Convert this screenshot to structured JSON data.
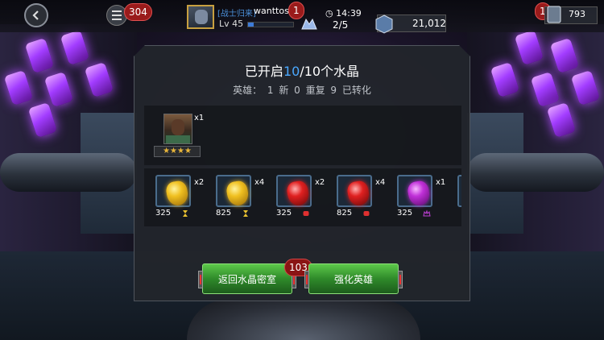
{
  "topbar": {
    "menu_badge": "304",
    "alliance_tag": "[战士归来]",
    "player_name": "wanttose",
    "level": "Lv 45",
    "xp_progress": 0.12,
    "profile_badge": "1",
    "timer": "14:39",
    "energy": "2/5",
    "gold": "21,012",
    "unit_badge": "1",
    "units": "793"
  },
  "dialog": {
    "title_prefix": "已开启",
    "title_count": "10",
    "title_suffix": "/10个水晶",
    "subtitle": "英雄： 1 新 0 重复 9 已转化",
    "hero": {
      "multiplier": "x1",
      "stars": "★★★★"
    },
    "crystals": [
      {
        "color": "gold",
        "multiplier": "x2",
        "value": "325",
        "type_icon": "hourglass-icon"
      },
      {
        "color": "gold",
        "multiplier": "x4",
        "value": "825",
        "type_icon": "hourglass-icon"
      },
      {
        "color": "red",
        "multiplier": "x2",
        "value": "325",
        "type_icon": "fist-icon"
      },
      {
        "color": "red",
        "multiplier": "x4",
        "value": "825",
        "type_icon": "fist-icon"
      },
      {
        "color": "purple",
        "multiplier": "x1",
        "value": "325",
        "type_icon": "crown-icon"
      }
    ],
    "return_button": "返回水晶密室",
    "return_badge": "103",
    "upgrade_button": "强化英雄"
  },
  "colors": {
    "accent_blue": "#4aa8ff",
    "button_green": "#2f8a2a",
    "badge_red": "#9a1b1b",
    "crystal_purple": "#a23cff"
  }
}
